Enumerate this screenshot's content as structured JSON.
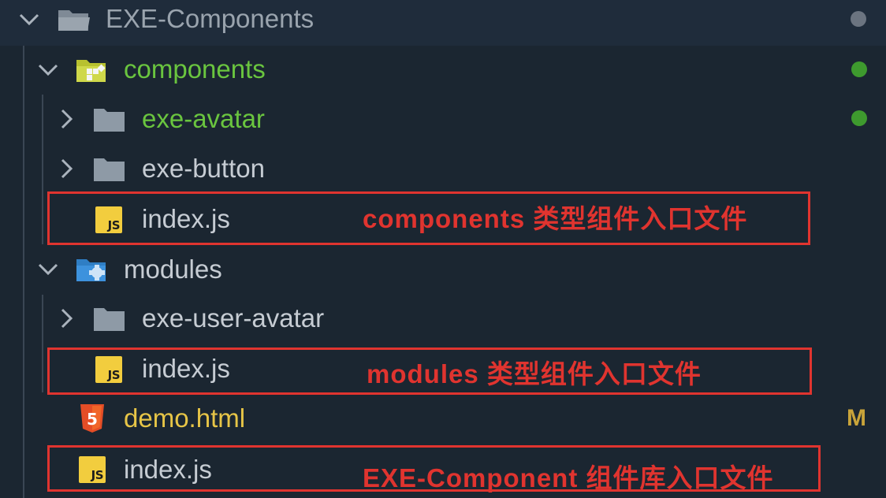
{
  "explorer": {
    "root": {
      "label": "EXE-Components",
      "status_dot_color": "#6b7480"
    },
    "items": [
      {
        "label": "components",
        "color": "#6ac53f",
        "status_dot_color": "#3e9a2e",
        "icon": "components-folder-icon"
      },
      {
        "label": "exe-avatar",
        "color": "#6ac53f",
        "status_dot_color": "#3e9a2e",
        "icon": "folder-icon"
      },
      {
        "label": "exe-button",
        "color": "#c6ccd3",
        "icon": "folder-icon"
      },
      {
        "label": "index.js",
        "color": "#c6ccd3",
        "icon": "js-file-icon",
        "icon_text": "JS"
      },
      {
        "label": "modules",
        "color": "#c6ccd3",
        "icon": "modules-folder-icon"
      },
      {
        "label": "exe-user-avatar",
        "color": "#c6ccd3",
        "icon": "folder-icon"
      },
      {
        "label": "index.js",
        "color": "#c6ccd3",
        "icon": "js-file-icon",
        "icon_text": "JS"
      },
      {
        "label": "demo.html",
        "color": "#e7c547",
        "badge": "M",
        "badge_color": "#c9a43a",
        "icon": "html5-icon",
        "icon_text": "5"
      },
      {
        "label": "index.js",
        "color": "#c6ccd3",
        "icon": "js-file-icon",
        "icon_text": "JS"
      }
    ]
  },
  "annotations": [
    {
      "text": "components 类型组件入口文件",
      "color": "#e0342f"
    },
    {
      "text": "modules 类型组件入口文件",
      "color": "#e0342f"
    },
    {
      "text": "EXE-Component 组件库入口文件",
      "color": "#e0342f"
    }
  ]
}
